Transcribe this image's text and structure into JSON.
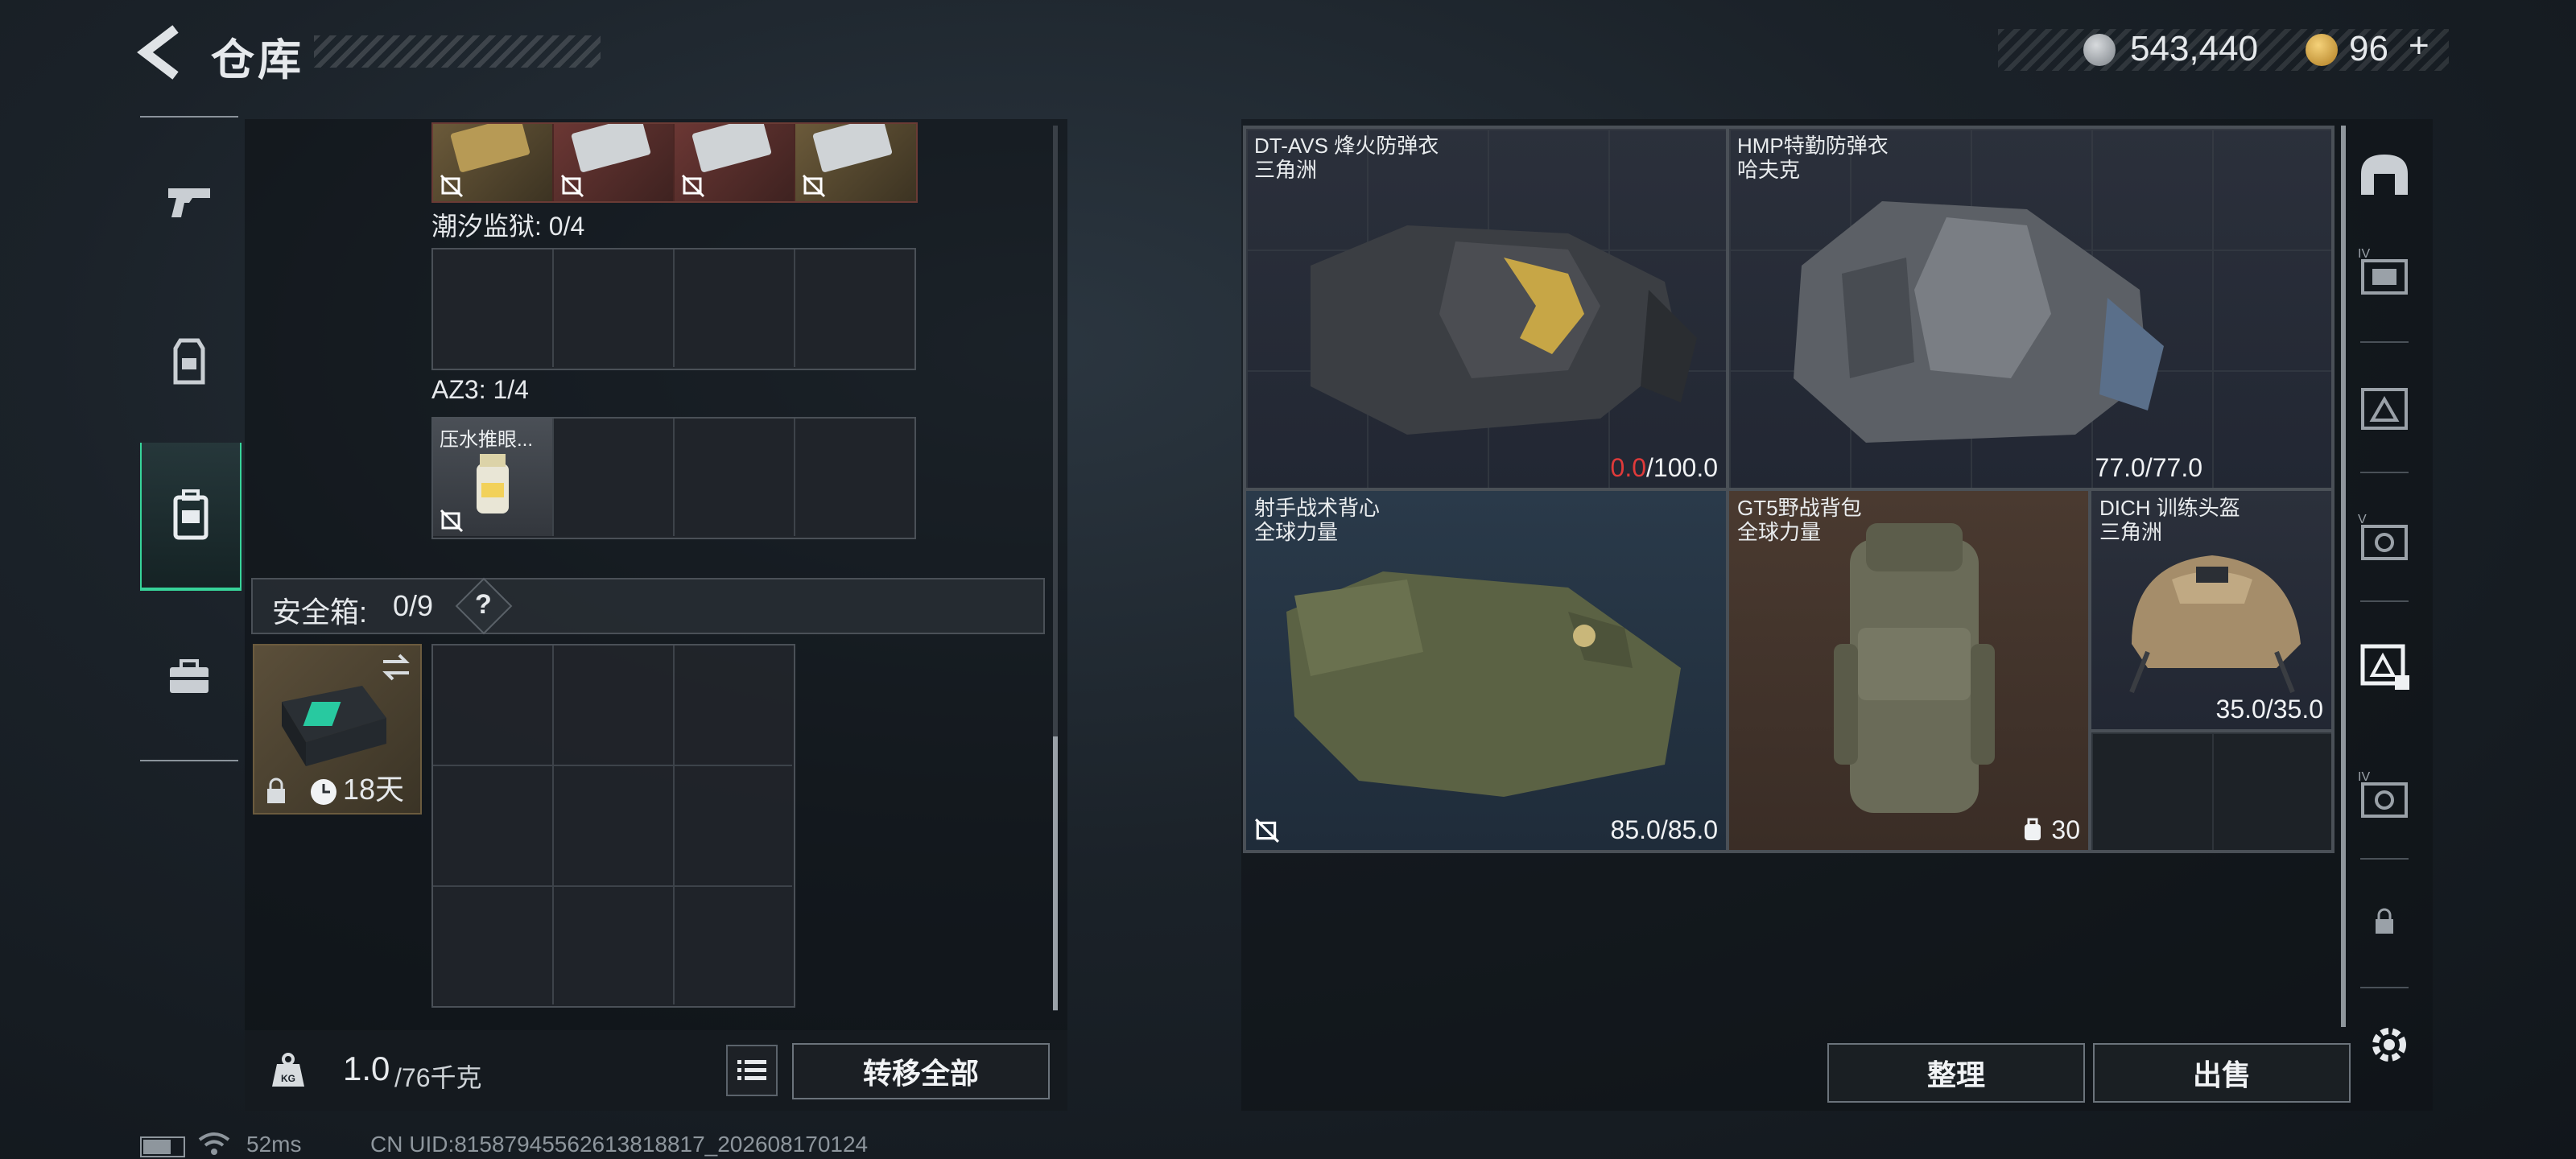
{
  "header": {
    "title": "仓库",
    "currency_primary": "543,440",
    "currency_secondary": "96",
    "currency_secondary_suffix": "+"
  },
  "left_rail": {
    "items": [
      {
        "name": "weapons",
        "icon": "pistol-icon",
        "active": false
      },
      {
        "name": "gear",
        "icon": "vest-icon",
        "active": false
      },
      {
        "name": "backpack",
        "icon": "backpack-icon",
        "active": true
      },
      {
        "name": "toolbox",
        "icon": "briefcase-icon",
        "active": false
      }
    ]
  },
  "containers": {
    "top_row_label": "",
    "tide_prison_label": "潮汐监狱: 0/4",
    "az3_label": "AZ3: 1/4",
    "az3_item_name": "压水推眼...",
    "safebox_label": "安全箱:",
    "safebox_count": "0/9",
    "safebox_help": "?",
    "safebox_timer": "18天"
  },
  "footer_left": {
    "weight_current": "1.0",
    "weight_max": "/76千克",
    "weight_icon": "KG",
    "transfer_all": "转移全部"
  },
  "equipment": [
    {
      "name": "DT-AVS 烽火防弹衣",
      "faction": "三角洲",
      "durability_current": "0.0",
      "durability_max": "/100.0"
    },
    {
      "name": "HMP特勤防弹衣",
      "faction": "哈夫克",
      "durability": "77.0/77.0"
    },
    {
      "name": "射手战术背心",
      "faction": "全球力量",
      "durability": "85.0/85.0"
    },
    {
      "name": "GT5野战背包",
      "faction": "全球力量",
      "capacity": "30"
    },
    {
      "name": "DICH 训练头盔",
      "faction": "三角洲",
      "durability": "35.0/35.0"
    }
  ],
  "right_rail": {
    "items": [
      "helmet-slot-icon",
      "armor-iv-icon",
      "rig-slot-icon",
      "armor-v-icon",
      "container-slot-icon",
      "armor-iv-2-icon",
      "lock-icon",
      "gear-icon"
    ]
  },
  "footer_right": {
    "sort": "整理",
    "sell": "出售"
  },
  "status_bar": {
    "ping": "52ms",
    "uid": "CN UID:8158794556261381881​7_202608170124"
  },
  "colors": {
    "accent_green": "#37d49a",
    "warning_red": "#e03a3a"
  }
}
